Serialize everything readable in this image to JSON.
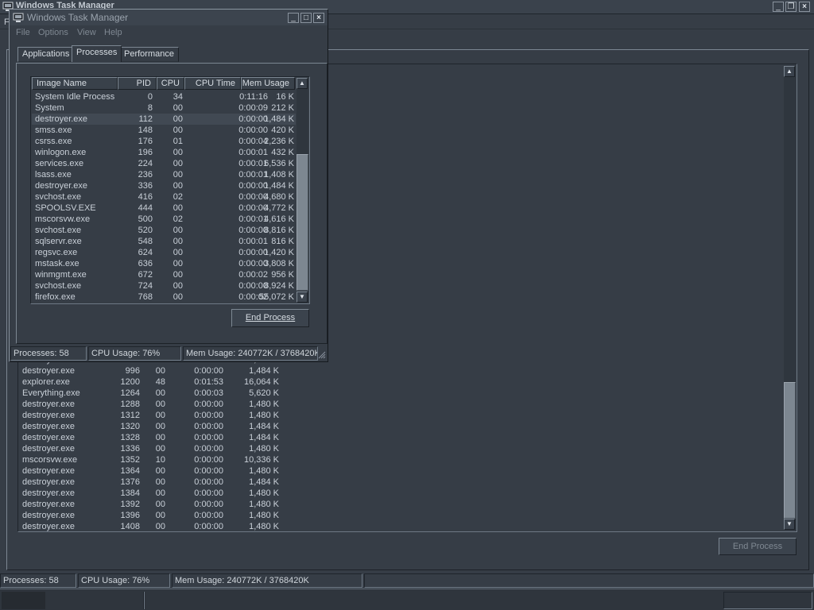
{
  "bg_window": {
    "title": "Windows Task Manager",
    "menu_first_letter": "F",
    "rows": [
      {
        "name": "destroyer.exe",
        "pid": "988",
        "cpu": "00",
        "time": "0:00:00",
        "mem": "1,484 K"
      },
      {
        "name": "destroyer.exe",
        "pid": "996",
        "cpu": "00",
        "time": "0:00:00",
        "mem": "1,484 K"
      },
      {
        "name": "explorer.exe",
        "pid": "1200",
        "cpu": "48",
        "time": "0:01:53",
        "mem": "16,064 K"
      },
      {
        "name": "Everything.exe",
        "pid": "1264",
        "cpu": "00",
        "time": "0:00:03",
        "mem": "5,620 K"
      },
      {
        "name": "destroyer.exe",
        "pid": "1288",
        "cpu": "00",
        "time": "0:00:00",
        "mem": "1,480 K"
      },
      {
        "name": "destroyer.exe",
        "pid": "1312",
        "cpu": "00",
        "time": "0:00:00",
        "mem": "1,480 K"
      },
      {
        "name": "destroyer.exe",
        "pid": "1320",
        "cpu": "00",
        "time": "0:00:00",
        "mem": "1,484 K"
      },
      {
        "name": "destroyer.exe",
        "pid": "1328",
        "cpu": "00",
        "time": "0:00:00",
        "mem": "1,484 K"
      },
      {
        "name": "destroyer.exe",
        "pid": "1336",
        "cpu": "00",
        "time": "0:00:00",
        "mem": "1,480 K"
      },
      {
        "name": "mscorsvw.exe",
        "pid": "1352",
        "cpu": "10",
        "time": "0:00:00",
        "mem": "10,336 K"
      },
      {
        "name": "destroyer.exe",
        "pid": "1364",
        "cpu": "00",
        "time": "0:00:00",
        "mem": "1,480 K"
      },
      {
        "name": "destroyer.exe",
        "pid": "1376",
        "cpu": "00",
        "time": "0:00:00",
        "mem": "1,484 K"
      },
      {
        "name": "destroyer.exe",
        "pid": "1384",
        "cpu": "00",
        "time": "0:00:00",
        "mem": "1,480 K"
      },
      {
        "name": "destroyer.exe",
        "pid": "1392",
        "cpu": "00",
        "time": "0:00:00",
        "mem": "1,480 K"
      },
      {
        "name": "destroyer.exe",
        "pid": "1396",
        "cpu": "00",
        "time": "0:00:00",
        "mem": "1,480 K"
      },
      {
        "name": "destroyer.exe",
        "pid": "1408",
        "cpu": "00",
        "time": "0:00:00",
        "mem": "1,480 K"
      }
    ],
    "end_process_label": "End Process",
    "status": {
      "processes": "Processes: 58",
      "cpu": "CPU Usage: 76%",
      "mem": "Mem Usage: 240772K / 3768420K"
    }
  },
  "fg_window": {
    "title": "Windows Task Manager",
    "menu": [
      "File",
      "Options",
      "View",
      "Help"
    ],
    "tabs": [
      "Applications",
      "Processes",
      "Performance"
    ],
    "active_tab": 1,
    "columns": [
      "Image Name",
      "PID",
      "CPU",
      "CPU Time",
      "Mem Usage"
    ],
    "rows": [
      {
        "name": "System Idle Process",
        "pid": "0",
        "cpu": "34",
        "time": "0:11:16",
        "mem": "16 K"
      },
      {
        "name": "System",
        "pid": "8",
        "cpu": "00",
        "time": "0:00:09",
        "mem": "212 K"
      },
      {
        "name": "destroyer.exe",
        "pid": "112",
        "cpu": "00",
        "time": "0:00:00",
        "mem": "1,484 K"
      },
      {
        "name": "smss.exe",
        "pid": "148",
        "cpu": "00",
        "time": "0:00:00",
        "mem": "420 K"
      },
      {
        "name": "csrss.exe",
        "pid": "176",
        "cpu": "01",
        "time": "0:00:04",
        "mem": "2,236 K"
      },
      {
        "name": "winlogon.exe",
        "pid": "196",
        "cpu": "00",
        "time": "0:00:01",
        "mem": "432 K"
      },
      {
        "name": "services.exe",
        "pid": "224",
        "cpu": "00",
        "time": "0:00:01",
        "mem": "6,536 K"
      },
      {
        "name": "lsass.exe",
        "pid": "236",
        "cpu": "00",
        "time": "0:00:01",
        "mem": "1,408 K"
      },
      {
        "name": "destroyer.exe",
        "pid": "336",
        "cpu": "00",
        "time": "0:00:00",
        "mem": "1,484 K"
      },
      {
        "name": "svchost.exe",
        "pid": "416",
        "cpu": "02",
        "time": "0:00:00",
        "mem": "4,680 K"
      },
      {
        "name": "SPOOLSV.EXE",
        "pid": "444",
        "cpu": "00",
        "time": "0:00:00",
        "mem": "4,772 K"
      },
      {
        "name": "mscorsvw.exe",
        "pid": "500",
        "cpu": "02",
        "time": "0:00:01",
        "mem": "4,616 K"
      },
      {
        "name": "svchost.exe",
        "pid": "520",
        "cpu": "00",
        "time": "0:00:00",
        "mem": "8,816 K"
      },
      {
        "name": "sqlservr.exe",
        "pid": "548",
        "cpu": "00",
        "time": "0:00:01",
        "mem": "816 K"
      },
      {
        "name": "regsvc.exe",
        "pid": "624",
        "cpu": "00",
        "time": "0:00:00",
        "mem": "1,420 K"
      },
      {
        "name": "mstask.exe",
        "pid": "636",
        "cpu": "00",
        "time": "0:00:00",
        "mem": "3,808 K"
      },
      {
        "name": "winmgmt.exe",
        "pid": "672",
        "cpu": "00",
        "time": "0:00:02",
        "mem": "956 K"
      },
      {
        "name": "svchost.exe",
        "pid": "724",
        "cpu": "00",
        "time": "0:00:00",
        "mem": "8,924 K"
      },
      {
        "name": "firefox.exe",
        "pid": "768",
        "cpu": "00",
        "time": "0:00:02",
        "mem": "55,072 K"
      }
    ],
    "selected_row": 2,
    "end_process_label": "End Process",
    "status": {
      "processes": "Processes: 58",
      "cpu": "CPU Usage: 76%",
      "mem": "Mem Usage: 240772K / 3768420K"
    }
  },
  "icons": {
    "monitor": "task-manager-monitor-icon",
    "minimize": "minimize-icon",
    "maximize": "maximize-icon",
    "restore": "restore-icon",
    "close": "close-icon",
    "scroll_up": "scroll-up-arrow-icon",
    "scroll_down": "scroll-down-arrow-icon",
    "sort": "sort-arrow-icon"
  },
  "colors": {
    "background": "#363d46",
    "selection": "#414953",
    "text": "#c9d0d8",
    "scroll_thumb": "#7d8791"
  }
}
